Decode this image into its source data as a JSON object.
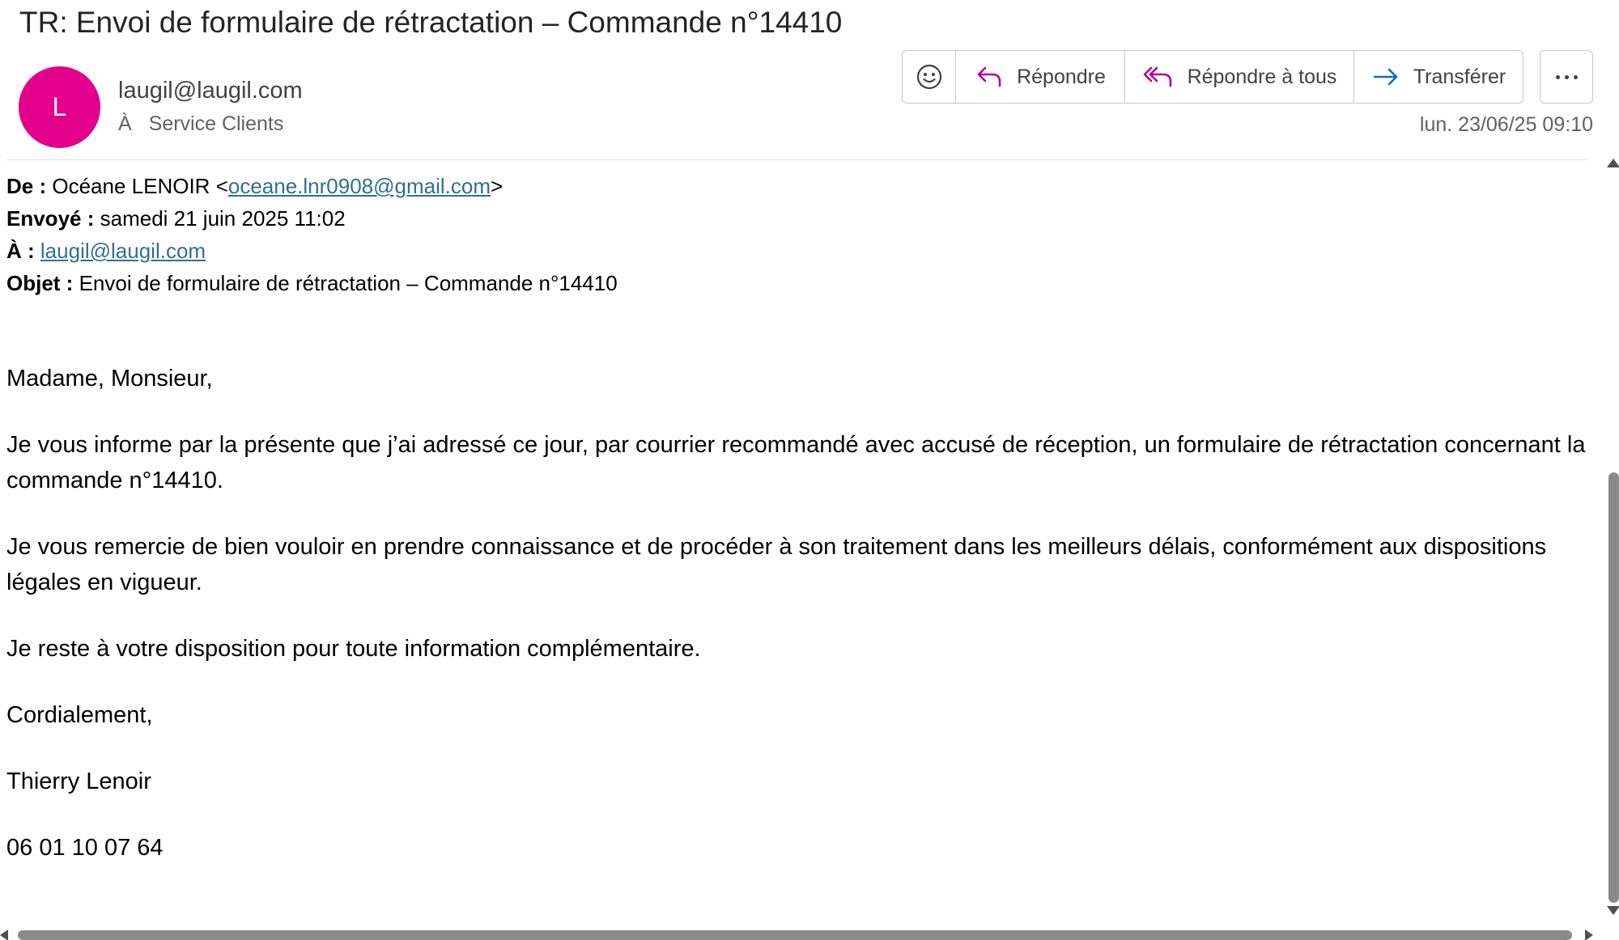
{
  "message": {
    "subject": "TR: Envoi de formulaire de rétractation – Commande n°14410",
    "avatar_initial": "L",
    "avatar_color": "#e3008c",
    "sender_address": "laugil@laugil.com",
    "to_prefix": "À",
    "to_recipient": "Service Clients",
    "date": "lun. 23/06/25 09:10"
  },
  "toolbar": {
    "emoji_icon": "smiley-icon",
    "reply_label": "Répondre",
    "reply_all_label": "Répondre à tous",
    "forward_label": "Transférer",
    "more_icon": "more-horizontal-icon",
    "reply_icon_color": "#b4009e",
    "forward_icon_color": "#0f6cbd"
  },
  "forwarded": {
    "from_label": "De :",
    "from_name": "Océane LENOIR <",
    "from_email": "oceane.lnr0908@gmail.com",
    "from_suffix": ">",
    "sent_label": "Envoyé :",
    "sent_value": "samedi 21 juin 2025 11:02",
    "to_label": "À :",
    "to_email": "laugil@laugil.com",
    "subject_label": "Objet :",
    "subject_value": "Envoi de formulaire de rétractation – Commande n°14410"
  },
  "body": {
    "greeting": "Madame, Monsieur,",
    "paragraph1": "Je vous informe par la présente que j’ai adressé ce jour, par courrier recommandé avec accusé de réception, un formulaire de rétractation concernant la commande n°14410.",
    "paragraph2": "Je vous remercie de bien vouloir en prendre connaissance et de procéder à son traitement dans les meilleurs délais, conformément aux dispositions légales en vigueur.",
    "paragraph3": "Je reste à votre disposition pour toute information complémentaire.",
    "closing": "Cordialement,",
    "signature_name": "Thierry Lenoir",
    "signature_phone": "06 01 10 07 64"
  }
}
